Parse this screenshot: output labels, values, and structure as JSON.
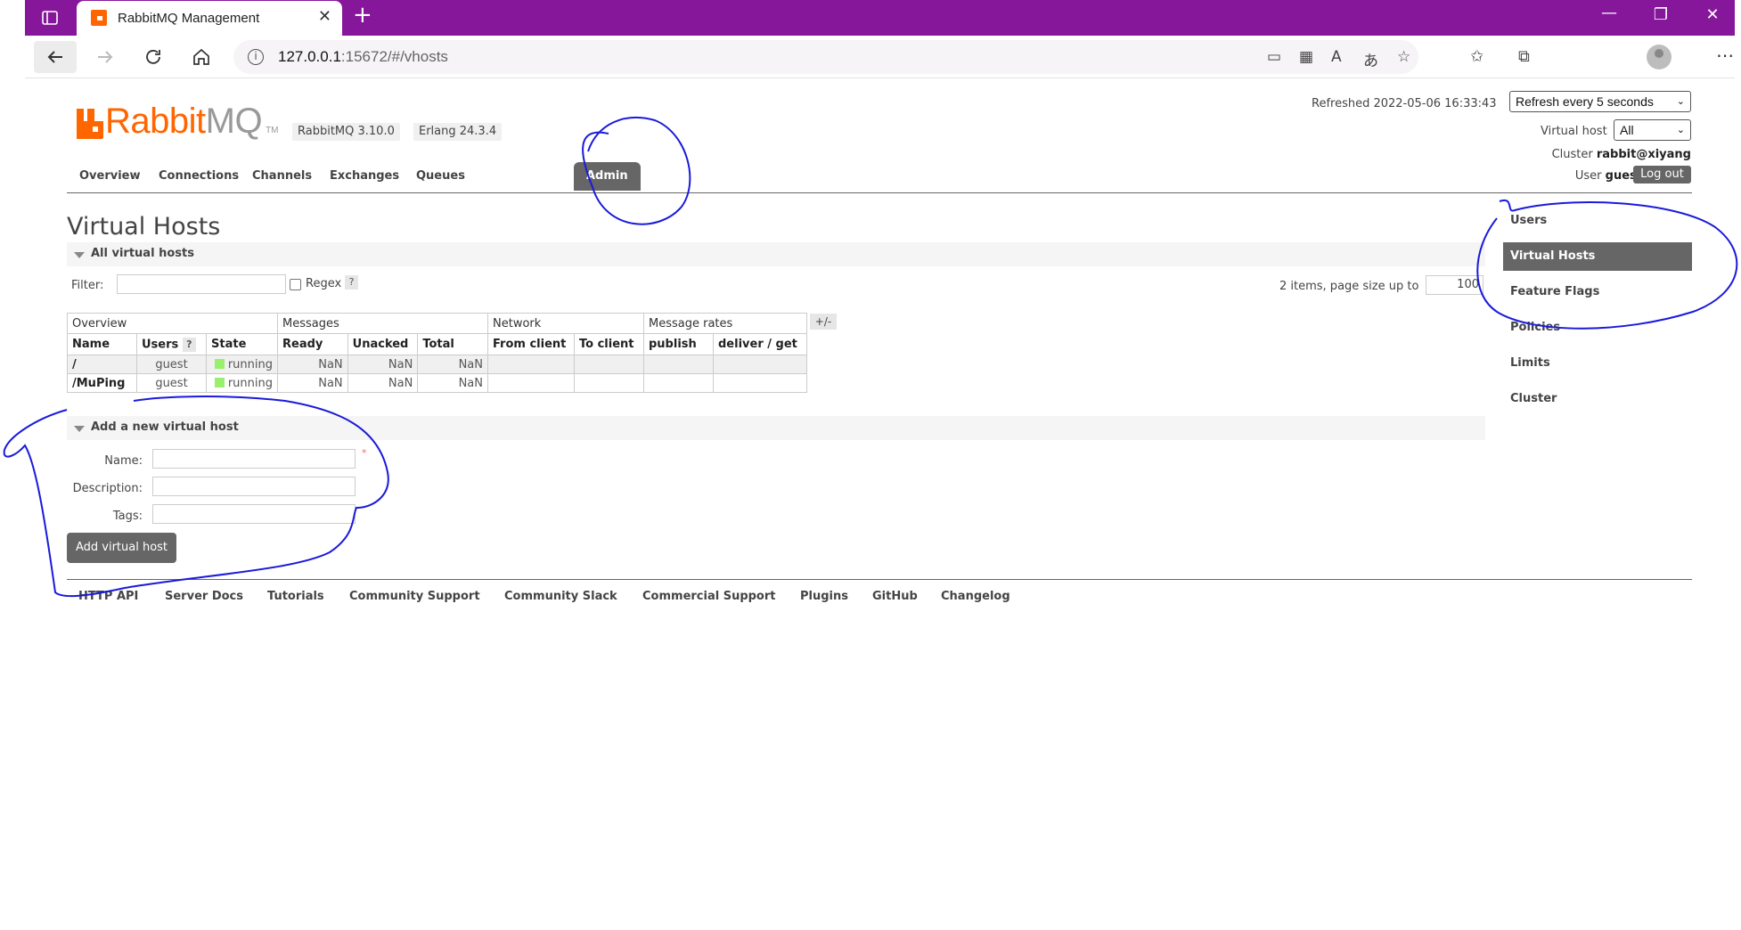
{
  "browser": {
    "tab_title": "RabbitMQ Management",
    "tab_close": "✕",
    "new_tab": "+",
    "url_host": "127.0.0.1",
    "url_path": ":15672/#/vhosts",
    "window_minimize": "—",
    "window_restore": "❐",
    "window_close": "✕"
  },
  "header": {
    "logo_rabbit": "Rabbit",
    "logo_mq": "MQ",
    "logo_tm": "TM",
    "version_rabbitmq": "RabbitMQ 3.10.0",
    "version_erlang": "Erlang 24.3.4",
    "refreshed_label": "Refreshed 2022-05-06 16:33:43",
    "refresh_select": "Refresh every 5 seconds",
    "vhost_label": "Virtual host",
    "vhost_select": "All",
    "cluster_label": "Cluster",
    "cluster_value": "rabbit@xiyang",
    "user_label": "User",
    "user_value": "guest",
    "logout": "Log out"
  },
  "main_tabs": [
    {
      "label": "Overview",
      "active": false
    },
    {
      "label": "Connections",
      "active": false
    },
    {
      "label": "Channels",
      "active": false
    },
    {
      "label": "Exchanges",
      "active": false
    },
    {
      "label": "Queues",
      "active": false
    },
    {
      "label": "Admin",
      "active": true
    }
  ],
  "page_title": "Virtual Hosts",
  "all_vhosts": {
    "section_label": "All virtual hosts",
    "filter_label": "Filter:",
    "regex_label": "Regex",
    "help": "?",
    "items_label": "2 items, page size up to",
    "page_size": "100",
    "plus_minus": "+/-",
    "group_headers": [
      "Overview",
      "Messages",
      "Network",
      "Message rates"
    ],
    "columns": [
      "Name",
      "Users",
      "State",
      "Ready",
      "Unacked",
      "Total",
      "From client",
      "To client",
      "publish",
      "deliver / get"
    ],
    "rows": [
      {
        "name": "/",
        "users": "guest",
        "state": "running",
        "ready": "NaN",
        "unacked": "NaN",
        "total": "NaN",
        "from_client": "",
        "to_client": "",
        "publish": "",
        "deliver_get": ""
      },
      {
        "name": "/MuPing",
        "users": "guest",
        "state": "running",
        "ready": "NaN",
        "unacked": "NaN",
        "total": "NaN",
        "from_client": "",
        "to_client": "",
        "publish": "",
        "deliver_get": ""
      }
    ]
  },
  "add_vhost": {
    "section_label": "Add a new virtual host",
    "name_label": "Name:",
    "description_label": "Description:",
    "tags_label": "Tags:",
    "required_mark": "*",
    "submit": "Add virtual host"
  },
  "side_nav": [
    {
      "label": "Users",
      "active": false
    },
    {
      "label": "Virtual Hosts",
      "active": true
    },
    {
      "label": "Feature Flags",
      "active": false
    },
    {
      "label": "Policies",
      "active": false
    },
    {
      "label": "Limits",
      "active": false
    },
    {
      "label": "Cluster",
      "active": false
    }
  ],
  "footer_links": [
    "HTTP API",
    "Server Docs",
    "Tutorials",
    "Community Support",
    "Community Slack",
    "Commercial Support",
    "Plugins",
    "GitHub",
    "Changelog"
  ],
  "annotation_color": "#1a1adb"
}
